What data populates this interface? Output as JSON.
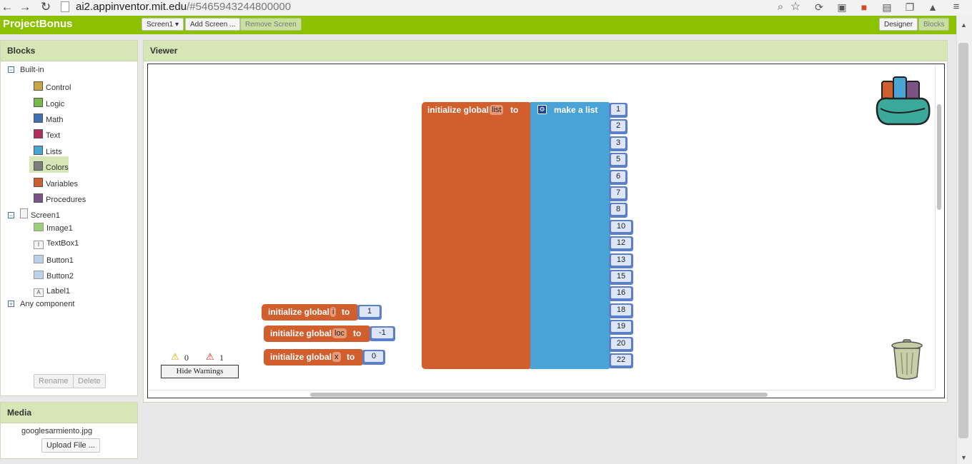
{
  "browser": {
    "url_host": "ai2.appinventor.mit.edu",
    "url_path": "/#5465943244800000"
  },
  "topbar": {
    "project_name": "ProjectBonus",
    "screen_dropdown": "Screen1 ▾",
    "add_screen": "Add Screen ...",
    "remove_screen": "Remove Screen",
    "designer": "Designer",
    "blocks": "Blocks"
  },
  "sidebar": {
    "title": "Blocks",
    "builtin_label": "Built-in",
    "builtin_items": [
      {
        "label": "Control",
        "color": "#c8a643"
      },
      {
        "label": "Logic",
        "color": "#77b84c"
      },
      {
        "label": "Math",
        "color": "#3f71b5"
      },
      {
        "label": "Text",
        "color": "#b32d5e"
      },
      {
        "label": "Lists",
        "color": "#49a6d4"
      },
      {
        "label": "Colors",
        "color": "#7d7d7d"
      },
      {
        "label": "Variables",
        "color": "#d05f2d"
      },
      {
        "label": "Procedures",
        "color": "#7c5385"
      }
    ],
    "screen_label": "Screen1",
    "screen_items": [
      "Image1",
      "TextBox1",
      "Button1",
      "Button2",
      "Label1"
    ],
    "any_component": "Any component",
    "rename": "Rename",
    "delete": "Delete"
  },
  "media": {
    "title": "Media",
    "file": "googlesarmiento.jpg",
    "upload": "Upload File ..."
  },
  "viewer": {
    "title": "Viewer",
    "warnings_count": "0",
    "errors_count": "1",
    "hide_warnings": "Hide Warnings",
    "list_block": {
      "init_text": "initialize global",
      "var_name": "list",
      "to_text": "to",
      "make_list": "make a list",
      "items": [
        "1",
        "2",
        "3",
        "5",
        "6",
        "7",
        "8",
        "10",
        "12",
        "13",
        "15",
        "16",
        "18",
        "19",
        "20",
        "22"
      ]
    },
    "var_blocks": [
      {
        "init_text": "initialize global",
        "name": "i",
        "to_text": "to",
        "value": "1"
      },
      {
        "init_text": "initialize global",
        "name": "loc",
        "to_text": "to",
        "value": "-1"
      },
      {
        "init_text": "initialize global",
        "name": "x",
        "to_text": "to",
        "value": "0"
      }
    ]
  }
}
